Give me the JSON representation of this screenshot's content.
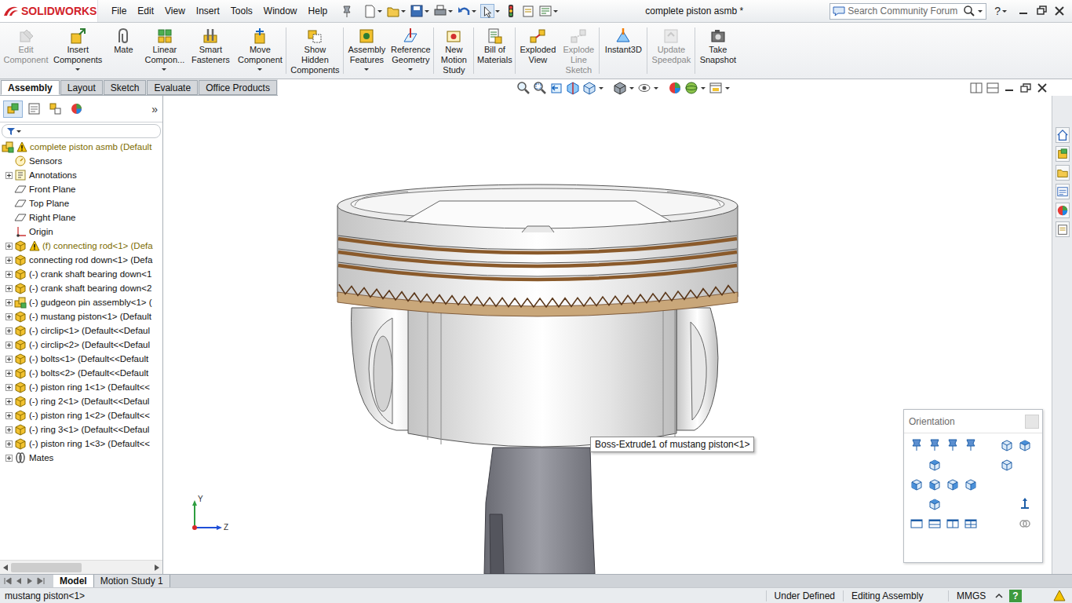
{
  "app": {
    "logo": "SOLIDWORKS",
    "title": "complete piston asmb *"
  },
  "menu": [
    "File",
    "Edit",
    "View",
    "Insert",
    "Tools",
    "Window",
    "Help"
  ],
  "search": {
    "placeholder": "Search Community Forum"
  },
  "help": "?",
  "ribbon": [
    {
      "lines": [
        "Edit",
        "Component"
      ],
      "disabled": true,
      "dropdown": false
    },
    {
      "lines": [
        "Insert",
        "Components"
      ],
      "disabled": false,
      "dropdown": true
    },
    {
      "lines": [
        "Mate"
      ],
      "disabled": false,
      "dropdown": false
    },
    {
      "lines": [
        "Linear",
        "Compon..."
      ],
      "disabled": false,
      "dropdown": true
    },
    {
      "lines": [
        "Smart",
        "Fasteners"
      ],
      "disabled": false,
      "dropdown": false
    },
    {
      "lines": [
        "Move",
        "Component"
      ],
      "disabled": false,
      "dropdown": true
    },
    {
      "lines": [
        "Show",
        "Hidden",
        "Components"
      ],
      "disabled": false,
      "dropdown": false
    },
    {
      "lines": [
        "Assembly",
        "Features"
      ],
      "disabled": false,
      "dropdown": true
    },
    {
      "lines": [
        "Reference",
        "Geometry"
      ],
      "disabled": false,
      "dropdown": true
    },
    {
      "lines": [
        "New",
        "Motion",
        "Study"
      ],
      "disabled": false,
      "dropdown": false
    },
    {
      "lines": [
        "Bill of",
        "Materials"
      ],
      "disabled": false,
      "dropdown": false
    },
    {
      "lines": [
        "Exploded",
        "View"
      ],
      "disabled": false,
      "dropdown": false
    },
    {
      "lines": [
        "Explode",
        "Line",
        "Sketch"
      ],
      "disabled": true,
      "dropdown": false
    },
    {
      "lines": [
        "Instant3D"
      ],
      "disabled": false,
      "dropdown": false
    },
    {
      "lines": [
        "Update",
        "Speedpak"
      ],
      "disabled": true,
      "dropdown": false
    },
    {
      "lines": [
        "Take",
        "Snapshot"
      ],
      "disabled": false,
      "dropdown": false
    }
  ],
  "command_tabs": [
    {
      "label": "Assembly",
      "selected": true
    },
    {
      "label": "Layout",
      "selected": false
    },
    {
      "label": "Sketch",
      "selected": false
    },
    {
      "label": "Evaluate",
      "selected": false
    },
    {
      "label": "Office Products",
      "selected": false
    }
  ],
  "feature_manager": {
    "tabs": [
      {
        "selected": true
      },
      {
        "selected": false
      },
      {
        "selected": false
      },
      {
        "selected": false
      }
    ],
    "more": "»"
  },
  "tree": [
    {
      "text": "complete piston asmb  (Default",
      "kind": "assembly",
      "expandable": false,
      "warning": true,
      "root": true
    },
    {
      "text": "Sensors",
      "kind": "sensor",
      "expandable": false,
      "warning": false,
      "root": false
    },
    {
      "text": "Annotations",
      "kind": "annotation",
      "expandable": true,
      "warning": false,
      "root": false
    },
    {
      "text": "Front Plane",
      "kind": "plane",
      "expandable": false,
      "warning": false,
      "root": false
    },
    {
      "text": "Top Plane",
      "kind": "plane",
      "expandable": false,
      "warning": false,
      "root": false
    },
    {
      "text": "Right Plane",
      "kind": "plane",
      "expandable": false,
      "warning": false,
      "root": false
    },
    {
      "text": "Origin",
      "kind": "origin",
      "expandable": false,
      "warning": false,
      "root": false
    },
    {
      "text": "(f) connecting rod<1> (Defa",
      "kind": "part",
      "expandable": true,
      "warning": true,
      "root": false
    },
    {
      "text": "connecting rod down<1> (Defa",
      "kind": "part",
      "expandable": true,
      "warning": false,
      "root": false
    },
    {
      "text": "(-) crank shaft bearing down<1",
      "kind": "part",
      "expandable": true,
      "warning": false,
      "root": false
    },
    {
      "text": "(-) crank shaft bearing down<2",
      "kind": "part",
      "expandable": true,
      "warning": false,
      "root": false
    },
    {
      "text": "(-) gudgeon pin assembly<1> (",
      "kind": "assembly",
      "expandable": true,
      "warning": false,
      "root": false
    },
    {
      "text": "(-) mustang piston<1> (Default",
      "kind": "part",
      "expandable": true,
      "warning": false,
      "root": false
    },
    {
      "text": "(-) circlip<1> (Default<<Defaul",
      "kind": "part",
      "expandable": true,
      "warning": false,
      "root": false
    },
    {
      "text": "(-) circlip<2> (Default<<Defaul",
      "kind": "part",
      "expandable": true,
      "warning": false,
      "root": false
    },
    {
      "text": "(-) bolts<1> (Default<<Default",
      "kind": "part",
      "expandable": true,
      "warning": false,
      "root": false
    },
    {
      "text": "(-) bolts<2> (Default<<Default",
      "kind": "part",
      "expandable": true,
      "warning": false,
      "root": false
    },
    {
      "text": "(-) piston ring 1<1> (Default<<",
      "kind": "part",
      "expandable": true,
      "warning": false,
      "root": false
    },
    {
      "text": "(-) ring 2<1> (Default<<Defaul",
      "kind": "part",
      "expandable": true,
      "warning": false,
      "root": false
    },
    {
      "text": "(-) piston ring 1<2> (Default<<",
      "kind": "part",
      "expandable": true,
      "warning": false,
      "root": false
    },
    {
      "text": "(-) ring 3<1> (Default<<Defaul",
      "kind": "part",
      "expandable": true,
      "warning": false,
      "root": false
    },
    {
      "text": "(-) piston ring 1<3> (Default<<",
      "kind": "part",
      "expandable": true,
      "warning": false,
      "root": false
    },
    {
      "text": "Mates",
      "kind": "mates",
      "expandable": true,
      "warning": false,
      "root": false
    }
  ],
  "tooltip": "Boss-Extrude1 of mustang piston<1>",
  "triad": [
    "Y",
    "Z"
  ],
  "orientation": {
    "title": "Orientation"
  },
  "bottom_tabs": [
    {
      "label": "Model",
      "selected": true
    },
    {
      "label": "Motion Study 1",
      "selected": false
    }
  ],
  "status_bar": {
    "left": "mustang piston<1>",
    "items": [
      "Under Defined",
      "Editing Assembly",
      "MMGS"
    ],
    "help": "?"
  }
}
